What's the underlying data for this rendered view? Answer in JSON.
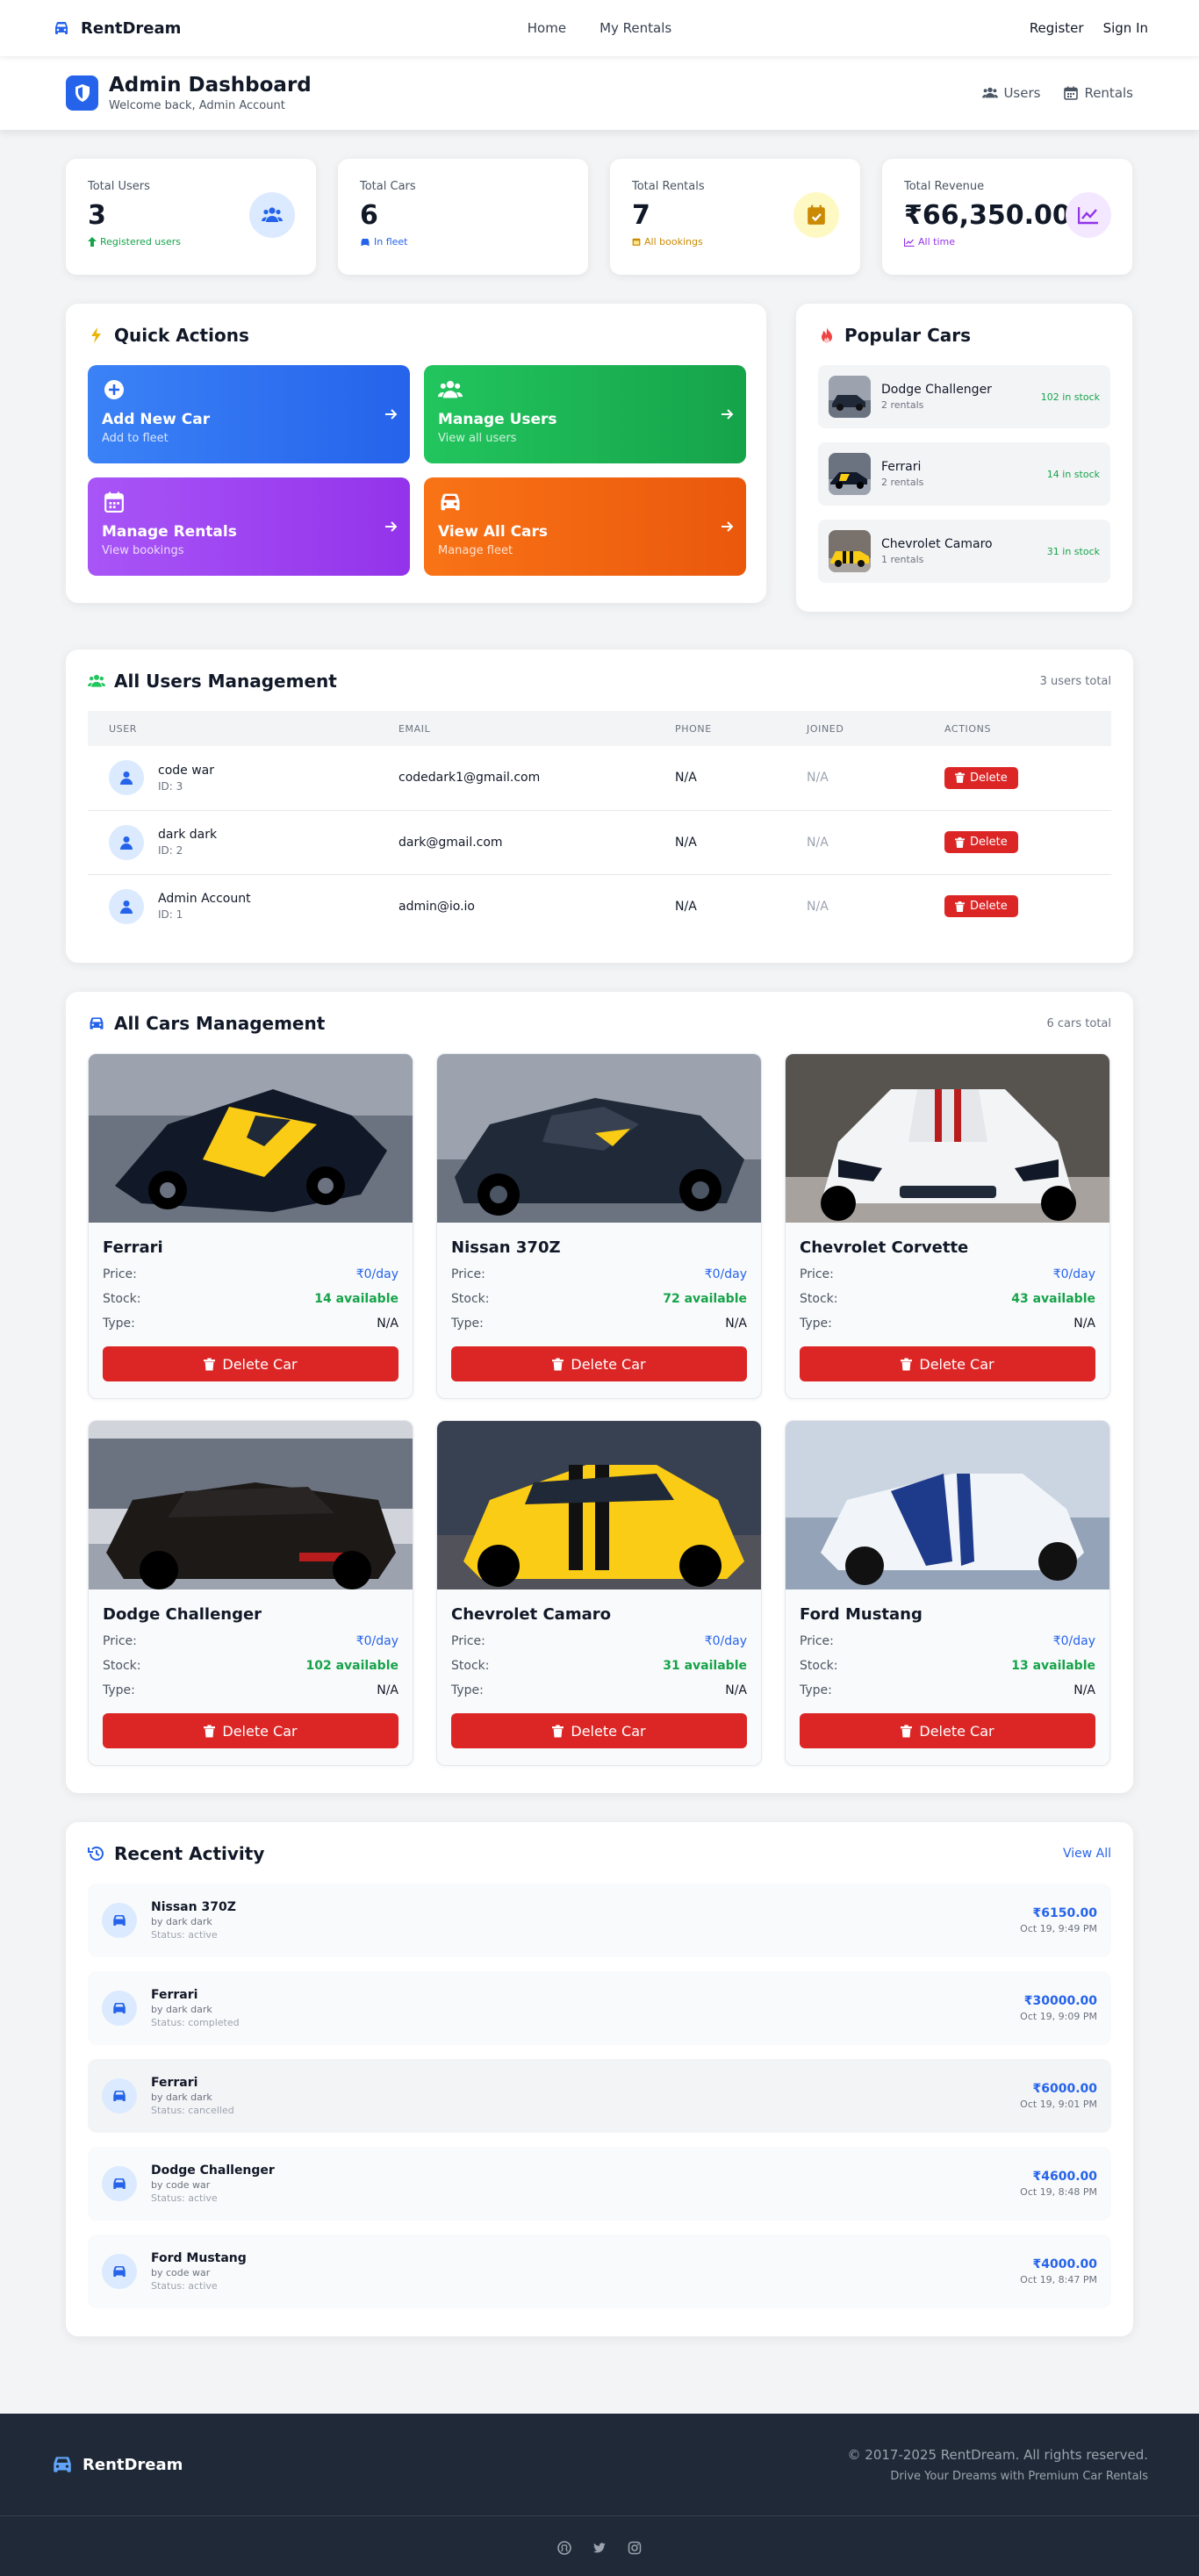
{
  "nav": {
    "brand": "RentDream",
    "home": "Home",
    "my_rentals": "My Rentals",
    "register": "Register",
    "sign_in": "Sign In"
  },
  "admin": {
    "title": "Admin Dashboard",
    "welcome": "Welcome back, Admin Account",
    "users_link": "Users",
    "rentals_link": "Rentals"
  },
  "stats": [
    {
      "label": "Total Users",
      "value": "3",
      "foot": "Registered users",
      "color": "#16a34a"
    },
    {
      "label": "Total Cars",
      "value": "6",
      "foot": "In fleet",
      "color": "#2563eb"
    },
    {
      "label": "Total Rentals",
      "value": "7",
      "foot": "All bookings",
      "color": "#ca8a04"
    },
    {
      "label": "Total Revenue",
      "value": "₹66,350.00",
      "foot": "All time",
      "color": "#9333ea"
    }
  ],
  "quick_actions": {
    "title": "Quick Actions",
    "items": [
      {
        "label": "Add New Car",
        "sub": "Add to fleet"
      },
      {
        "label": "Manage Users",
        "sub": "View all users"
      },
      {
        "label": "Manage Rentals",
        "sub": "View bookings"
      },
      {
        "label": "View All Cars",
        "sub": "Manage fleet"
      }
    ]
  },
  "popular": {
    "title": "Popular Cars",
    "items": [
      {
        "name": "Dodge Challenger",
        "rentals": "2 rentals",
        "stock": "102 in stock"
      },
      {
        "name": "Ferrari",
        "rentals": "2 rentals",
        "stock": "14 in stock"
      },
      {
        "name": "Chevrolet Camaro",
        "rentals": "1 rentals",
        "stock": "31 in stock"
      }
    ]
  },
  "users": {
    "title": "All Users Management",
    "count": "3 users total",
    "columns": [
      "USER",
      "EMAIL",
      "PHONE",
      "JOINED",
      "ACTIONS"
    ],
    "rows": [
      {
        "name": "code war",
        "id": "ID: 3",
        "email": "codedark1@gmail.com",
        "phone": "N/A",
        "joined": "N/A",
        "action": "Delete"
      },
      {
        "name": "dark dark",
        "id": "ID: 2",
        "email": "dark@gmail.com",
        "phone": "N/A",
        "joined": "N/A",
        "action": "Delete"
      },
      {
        "name": "Admin Account",
        "id": "ID: 1",
        "email": "admin@io.io",
        "phone": "N/A",
        "joined": "N/A",
        "action": "Delete"
      }
    ]
  },
  "cars": {
    "title": "All Cars Management",
    "count": "6 cars total",
    "price_label": "Price:",
    "stock_label": "Stock:",
    "type_label": "Type:",
    "delete_label": "Delete Car",
    "items": [
      {
        "name": "Ferrari",
        "price": "₹0/day",
        "stock": "14 available",
        "type": "N/A"
      },
      {
        "name": "Nissan 370Z",
        "price": "₹0/day",
        "stock": "72 available",
        "type": "N/A"
      },
      {
        "name": "Chevrolet Corvette",
        "price": "₹0/day",
        "stock": "43 available",
        "type": "N/A"
      },
      {
        "name": "Dodge Challenger",
        "price": "₹0/day",
        "stock": "102 available",
        "type": "N/A"
      },
      {
        "name": "Chevrolet Camaro",
        "price": "₹0/day",
        "stock": "31 available",
        "type": "N/A"
      },
      {
        "name": "Ford Mustang",
        "price": "₹0/day",
        "stock": "13 available",
        "type": "N/A"
      }
    ]
  },
  "activity": {
    "title": "Recent Activity",
    "view_all": "View All",
    "items": [
      {
        "car": "Nissan 370Z",
        "by": "by dark dark",
        "status": "Status: active",
        "amount": "₹6150.00",
        "time": "Oct 19, 9:49 PM"
      },
      {
        "car": "Ferrari",
        "by": "by dark dark",
        "status": "Status: completed",
        "amount": "₹30000.00",
        "time": "Oct 19, 9:09 PM"
      },
      {
        "car": "Ferrari",
        "by": "by dark dark",
        "status": "Status: cancelled",
        "amount": "₹6000.00",
        "time": "Oct 19, 9:01 PM"
      },
      {
        "car": "Dodge Challenger",
        "by": "by code war",
        "status": "Status: active",
        "amount": "₹4600.00",
        "time": "Oct 19, 8:48 PM"
      },
      {
        "car": "Ford Mustang",
        "by": "by code war",
        "status": "Status: active",
        "amount": "₹4000.00",
        "time": "Oct 19, 8:47 PM"
      }
    ]
  },
  "footer": {
    "brand": "RentDream",
    "copyright": "© 2017-2025 RentDream. All rights reserved.",
    "tagline": "Drive Your Dreams with Premium Car Rentals"
  },
  "colors": {
    "primary": "#2563eb",
    "danger": "#dc2626",
    "success": "#16a34a",
    "footer_bg": "#1f2937"
  }
}
